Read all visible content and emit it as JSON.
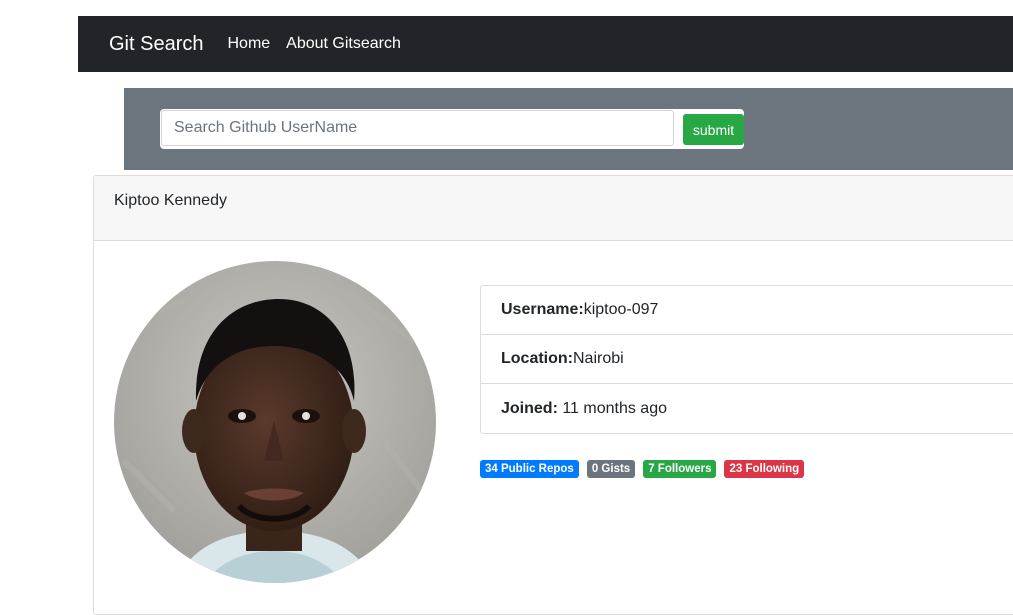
{
  "navbar": {
    "brand": "Git Search",
    "links": [
      "Home",
      "About Gitsearch"
    ]
  },
  "search": {
    "placeholder": "Search Github UserName",
    "value": "",
    "submit_label": "submit"
  },
  "profile": {
    "name": "Kiptoo Kennedy",
    "details": [
      {
        "label": "Username:",
        "value": "kiptoo-097"
      },
      {
        "label": "Location:",
        "value": "Nairobi"
      },
      {
        "label": "Joined:",
        "value": " 11 months ago"
      }
    ],
    "badges": {
      "repos": "34 Public Repos",
      "gists": "0 Gists",
      "followers": "7 Followers",
      "following": "23 Following"
    }
  },
  "colors": {
    "navbar_bg": "#212529",
    "search_band_bg": "#6c757d",
    "submit_green": "#28a745",
    "badge_blue": "#007bff",
    "badge_gray": "#6c757d",
    "badge_green": "#28a745",
    "badge_red": "#dc3545"
  }
}
